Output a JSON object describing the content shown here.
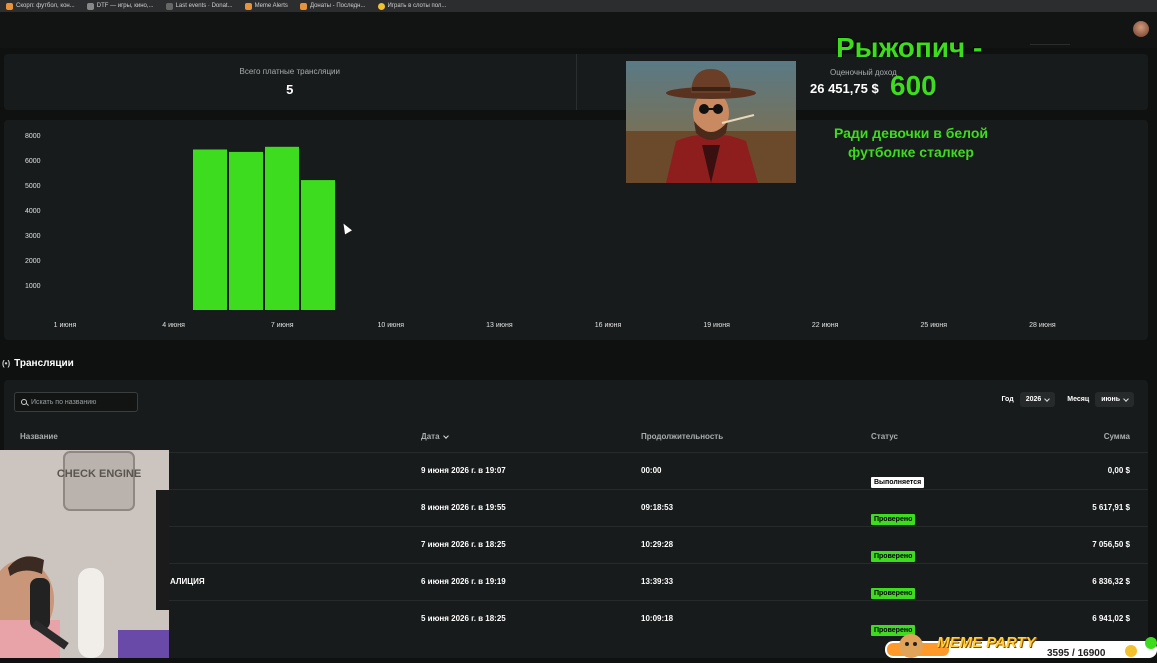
{
  "bookmarks": [
    "Скорп: футбол, кон...",
    "DTF — игры, кино,...",
    "Last events · Donat...",
    "Meme Alerts",
    "Донаты - Последн...",
    "Играть в слоты пол..."
  ],
  "stats": {
    "paid_label": "Всего платные трансляции",
    "paid_value": "5",
    "income_label": "Оценочный доход",
    "income_value": "26 451,75 $"
  },
  "chart_data": {
    "type": "bar",
    "categories": [
      "5 июня",
      "6 июня",
      "7 июня",
      "8 июня"
    ],
    "values": [
      6941.02,
      6836.32,
      7056.5,
      5617.91
    ],
    "y_ticks": [
      "8000",
      "6000",
      "5000",
      "4000",
      "3000",
      "2000",
      "1000"
    ],
    "x_ticks": [
      "1 июня",
      "4 июня",
      "7 июня",
      "10 июня",
      "13 июня",
      "16 июня",
      "19 июня",
      "22 июня",
      "25 июня",
      "28 июня"
    ],
    "bar_color": "#3edc1e",
    "grid": false
  },
  "overlay": {
    "donor": "Рыжопич -",
    "amount": "600",
    "message": "Ради девочки в белой футболке сталкер"
  },
  "section": {
    "title": "Трансляции"
  },
  "search": {
    "placeholder": "Искать по названию"
  },
  "filters": {
    "year_label": "Год",
    "year_value": "2026",
    "month_label": "Месяц",
    "month_value": "июнь"
  },
  "table": {
    "headers": [
      "Название",
      "Дата",
      "Продолжительность",
      "Статус",
      "Сумма"
    ],
    "rows": [
      {
        "name": "",
        "date": "9 июня 2026 г. в 19:07",
        "duration": "00:00",
        "status": "Выполняется",
        "sum": "0,00 $"
      },
      {
        "name": "",
        "date": "8 июня 2026 г. в 19:55",
        "duration": "09:18:53",
        "status": "Проверено",
        "sum": "5 617,91 $"
      },
      {
        "name": "",
        "date": "7 июня 2026 г. в 18:25",
        "duration": "10:29:28",
        "status": "Проверено",
        "sum": "7 056,50 $"
      },
      {
        "name": "АЛИЦИЯ",
        "date": "6 июня 2026 г. в 19:19",
        "duration": "13:39:33",
        "status": "Проверено",
        "sum": "6 836,32 $"
      },
      {
        "name": "",
        "date": "5 июня 2026 г. в 18:25",
        "duration": "10:09:18",
        "status": "Проверено",
        "sum": "6 941,02 $"
      }
    ]
  },
  "webcam": {
    "sign": "CHECK ENGINE"
  },
  "meme": {
    "title": "MEME PARTY",
    "count": "3595 / 16900"
  },
  "colors": {
    "accent": "#3edc1e",
    "bg": "#0f1111",
    "card": "#181b1b"
  }
}
